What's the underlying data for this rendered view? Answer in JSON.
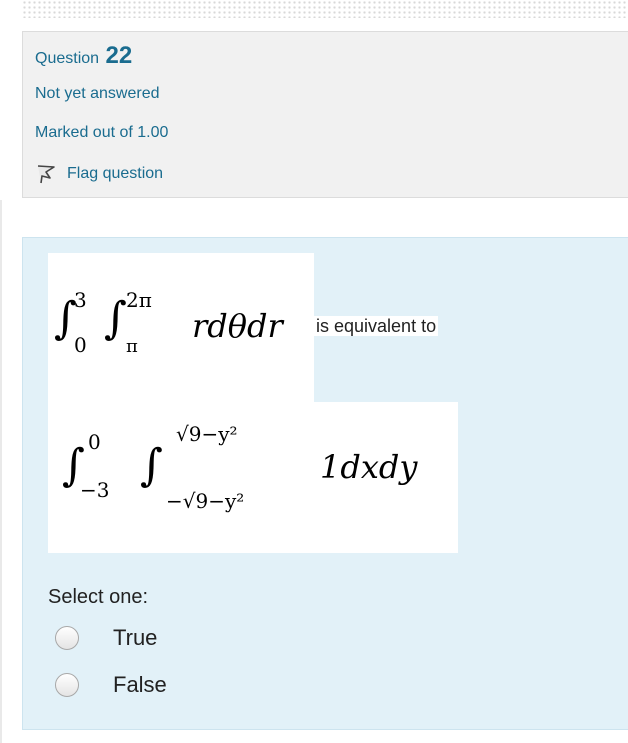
{
  "question": {
    "label": "Question",
    "number": "22",
    "state": "Not yet answered",
    "grade": "Marked out of 1.00",
    "flag_label": "Flag question",
    "flag_icon": "flag-icon"
  },
  "content": {
    "integral1": {
      "outer_upper": "3",
      "outer_lower": "0",
      "inner_upper": "2π",
      "inner_lower": "π",
      "integrand": "rdθdr"
    },
    "phrase": "is equivalent to",
    "integral2": {
      "outer_upper": "0",
      "outer_lower": "−3",
      "inner_upper": "√9−y²",
      "inner_lower": "−√9−y²",
      "integrand": "1dxdy"
    }
  },
  "answer": {
    "prompt": "Select one:",
    "options": [
      {
        "label": "True",
        "checked": false
      },
      {
        "label": "False",
        "checked": false
      }
    ]
  },
  "colors": {
    "link": "#1a6c8f",
    "info_background": "#f1f1f1",
    "content_background": "#e2f1f8"
  }
}
